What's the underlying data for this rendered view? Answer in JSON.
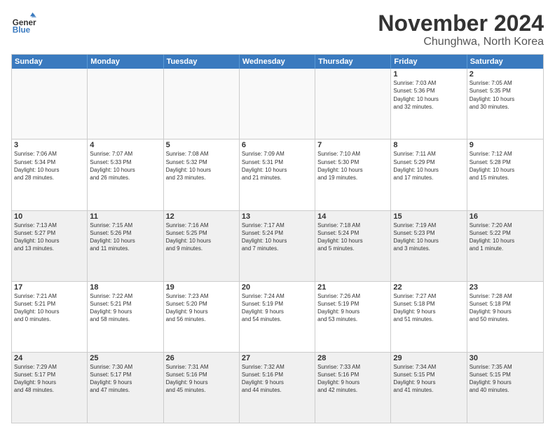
{
  "logo": {
    "line1": "General",
    "line2": "Blue"
  },
  "title": "November 2024",
  "subtitle": "Chunghwa, North Korea",
  "header": {
    "days": [
      "Sunday",
      "Monday",
      "Tuesday",
      "Wednesday",
      "Thursday",
      "Friday",
      "Saturday"
    ]
  },
  "weeks": [
    [
      {
        "day": "",
        "empty": true
      },
      {
        "day": "",
        "empty": true
      },
      {
        "day": "",
        "empty": true
      },
      {
        "day": "",
        "empty": true
      },
      {
        "day": "",
        "empty": true
      },
      {
        "day": "1",
        "info": "Sunrise: 7:03 AM\nSunset: 5:36 PM\nDaylight: 10 hours\nand 32 minutes."
      },
      {
        "day": "2",
        "info": "Sunrise: 7:05 AM\nSunset: 5:35 PM\nDaylight: 10 hours\nand 30 minutes."
      }
    ],
    [
      {
        "day": "3",
        "info": "Sunrise: 7:06 AM\nSunset: 5:34 PM\nDaylight: 10 hours\nand 28 minutes."
      },
      {
        "day": "4",
        "info": "Sunrise: 7:07 AM\nSunset: 5:33 PM\nDaylight: 10 hours\nand 26 minutes."
      },
      {
        "day": "5",
        "info": "Sunrise: 7:08 AM\nSunset: 5:32 PM\nDaylight: 10 hours\nand 23 minutes."
      },
      {
        "day": "6",
        "info": "Sunrise: 7:09 AM\nSunset: 5:31 PM\nDaylight: 10 hours\nand 21 minutes."
      },
      {
        "day": "7",
        "info": "Sunrise: 7:10 AM\nSunset: 5:30 PM\nDaylight: 10 hours\nand 19 minutes."
      },
      {
        "day": "8",
        "info": "Sunrise: 7:11 AM\nSunset: 5:29 PM\nDaylight: 10 hours\nand 17 minutes."
      },
      {
        "day": "9",
        "info": "Sunrise: 7:12 AM\nSunset: 5:28 PM\nDaylight: 10 hours\nand 15 minutes."
      }
    ],
    [
      {
        "day": "10",
        "info": "Sunrise: 7:13 AM\nSunset: 5:27 PM\nDaylight: 10 hours\nand 13 minutes.",
        "shaded": true
      },
      {
        "day": "11",
        "info": "Sunrise: 7:15 AM\nSunset: 5:26 PM\nDaylight: 10 hours\nand 11 minutes.",
        "shaded": true
      },
      {
        "day": "12",
        "info": "Sunrise: 7:16 AM\nSunset: 5:25 PM\nDaylight: 10 hours\nand 9 minutes.",
        "shaded": true
      },
      {
        "day": "13",
        "info": "Sunrise: 7:17 AM\nSunset: 5:24 PM\nDaylight: 10 hours\nand 7 minutes.",
        "shaded": true
      },
      {
        "day": "14",
        "info": "Sunrise: 7:18 AM\nSunset: 5:24 PM\nDaylight: 10 hours\nand 5 minutes.",
        "shaded": true
      },
      {
        "day": "15",
        "info": "Sunrise: 7:19 AM\nSunset: 5:23 PM\nDaylight: 10 hours\nand 3 minutes.",
        "shaded": true
      },
      {
        "day": "16",
        "info": "Sunrise: 7:20 AM\nSunset: 5:22 PM\nDaylight: 10 hours\nand 1 minute.",
        "shaded": true
      }
    ],
    [
      {
        "day": "17",
        "info": "Sunrise: 7:21 AM\nSunset: 5:21 PM\nDaylight: 10 hours\nand 0 minutes."
      },
      {
        "day": "18",
        "info": "Sunrise: 7:22 AM\nSunset: 5:21 PM\nDaylight: 9 hours\nand 58 minutes."
      },
      {
        "day": "19",
        "info": "Sunrise: 7:23 AM\nSunset: 5:20 PM\nDaylight: 9 hours\nand 56 minutes."
      },
      {
        "day": "20",
        "info": "Sunrise: 7:24 AM\nSunset: 5:19 PM\nDaylight: 9 hours\nand 54 minutes."
      },
      {
        "day": "21",
        "info": "Sunrise: 7:26 AM\nSunset: 5:19 PM\nDaylight: 9 hours\nand 53 minutes."
      },
      {
        "day": "22",
        "info": "Sunrise: 7:27 AM\nSunset: 5:18 PM\nDaylight: 9 hours\nand 51 minutes."
      },
      {
        "day": "23",
        "info": "Sunrise: 7:28 AM\nSunset: 5:18 PM\nDaylight: 9 hours\nand 50 minutes."
      }
    ],
    [
      {
        "day": "24",
        "info": "Sunrise: 7:29 AM\nSunset: 5:17 PM\nDaylight: 9 hours\nand 48 minutes.",
        "shaded": true
      },
      {
        "day": "25",
        "info": "Sunrise: 7:30 AM\nSunset: 5:17 PM\nDaylight: 9 hours\nand 47 minutes.",
        "shaded": true
      },
      {
        "day": "26",
        "info": "Sunrise: 7:31 AM\nSunset: 5:16 PM\nDaylight: 9 hours\nand 45 minutes.",
        "shaded": true
      },
      {
        "day": "27",
        "info": "Sunrise: 7:32 AM\nSunset: 5:16 PM\nDaylight: 9 hours\nand 44 minutes.",
        "shaded": true
      },
      {
        "day": "28",
        "info": "Sunrise: 7:33 AM\nSunset: 5:16 PM\nDaylight: 9 hours\nand 42 minutes.",
        "shaded": true
      },
      {
        "day": "29",
        "info": "Sunrise: 7:34 AM\nSunset: 5:15 PM\nDaylight: 9 hours\nand 41 minutes.",
        "shaded": true
      },
      {
        "day": "30",
        "info": "Sunrise: 7:35 AM\nSunset: 5:15 PM\nDaylight: 9 hours\nand 40 minutes.",
        "shaded": true
      }
    ]
  ]
}
